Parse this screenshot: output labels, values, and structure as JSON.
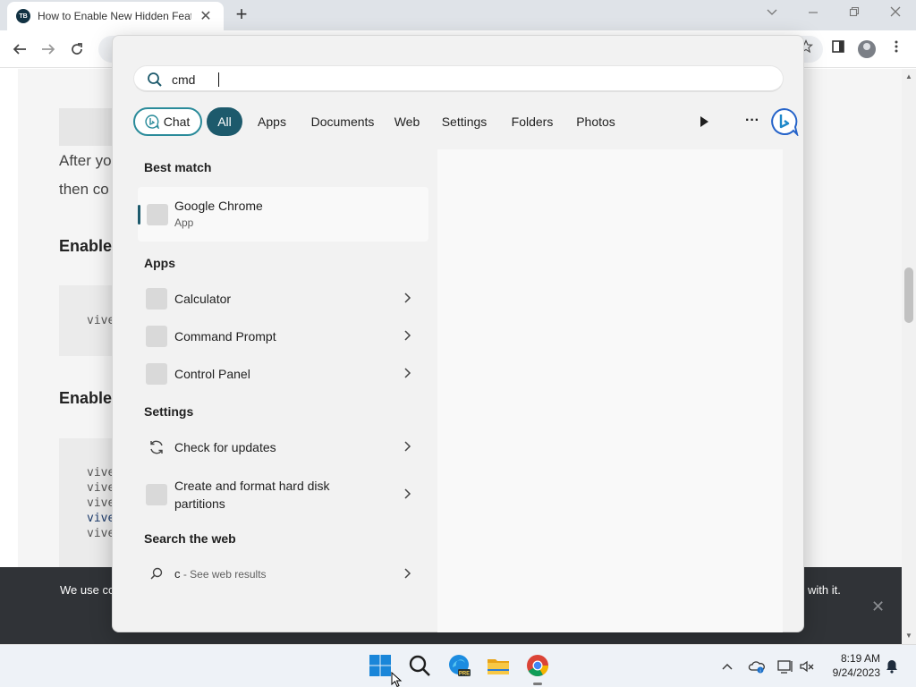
{
  "browser": {
    "tab_title": "How to Enable New Hidden Feat",
    "tab_favicon": "TB",
    "tab_close": "✕",
    "new_tab": "+",
    "window_controls": [
      "chevron-down-icon",
      "minimize-icon",
      "restore-icon",
      "close-icon"
    ]
  },
  "page": {
    "para_line1": "After yo",
    "para_line2": "then co",
    "heading1": "Enable",
    "heading2": "Enable",
    "code_block1": [
      "vive"
    ],
    "code_block2": [
      "vive",
      "vive",
      "vive",
      "vive",
      "vive"
    ]
  },
  "cookie_banner": {
    "text_left": "We use co",
    "text_right": "with it.",
    "close": "✕"
  },
  "search": {
    "query": "cmd",
    "filters": {
      "chat": "Chat",
      "all": "All",
      "apps": "Apps",
      "documents": "Documents",
      "web": "Web",
      "settings": "Settings",
      "folders": "Folders",
      "photos": "Photos",
      "more": "···"
    },
    "best_match_heading": "Best match",
    "best_match": {
      "title": "Google Chrome",
      "subtitle": "App"
    },
    "apps_heading": "Apps",
    "apps": [
      "Calculator",
      "Command Prompt",
      "Control Panel"
    ],
    "settings_heading": "Settings",
    "settings": [
      "Check for updates",
      "Create and format hard disk partitions"
    ],
    "web_heading": "Search the web",
    "web": {
      "query": "c",
      "suffix": " - See web results"
    }
  },
  "taskbar": {
    "apps": [
      "windows-start-icon",
      "search-icon",
      "edge-pre-icon",
      "file-explorer-icon",
      "chrome-icon"
    ],
    "tray": [
      "chevron-up-icon",
      "onedrive-icon",
      "network-icon",
      "volume-muted-icon",
      "notification-bell-icon"
    ],
    "time": "8:19 AM",
    "date": "9/24/2023"
  },
  "colors": {
    "accent": "#1d5a6c",
    "chat_border": "#2a8b9a",
    "panel_bg": "#f2f2f2",
    "cookie_bg": "#303337"
  }
}
